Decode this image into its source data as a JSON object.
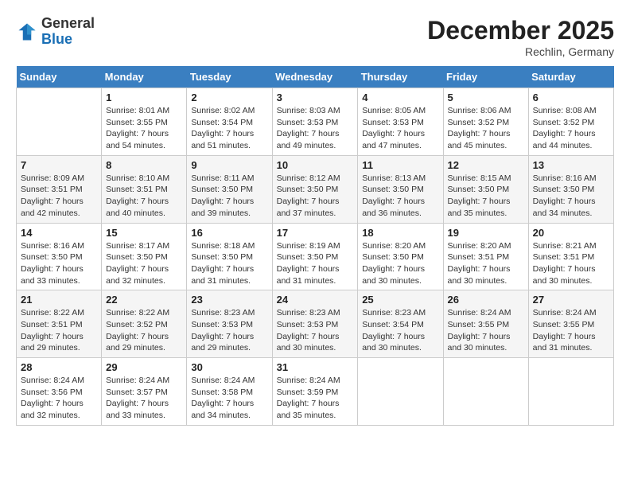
{
  "header": {
    "logo_general": "General",
    "logo_blue": "Blue",
    "month_title": "December 2025",
    "location": "Rechlin, Germany"
  },
  "weekdays": [
    "Sunday",
    "Monday",
    "Tuesday",
    "Wednesday",
    "Thursday",
    "Friday",
    "Saturday"
  ],
  "weeks": [
    [
      {
        "day": "",
        "info": ""
      },
      {
        "day": "1",
        "info": "Sunrise: 8:01 AM\nSunset: 3:55 PM\nDaylight: 7 hours\nand 54 minutes."
      },
      {
        "day": "2",
        "info": "Sunrise: 8:02 AM\nSunset: 3:54 PM\nDaylight: 7 hours\nand 51 minutes."
      },
      {
        "day": "3",
        "info": "Sunrise: 8:03 AM\nSunset: 3:53 PM\nDaylight: 7 hours\nand 49 minutes."
      },
      {
        "day": "4",
        "info": "Sunrise: 8:05 AM\nSunset: 3:53 PM\nDaylight: 7 hours\nand 47 minutes."
      },
      {
        "day": "5",
        "info": "Sunrise: 8:06 AM\nSunset: 3:52 PM\nDaylight: 7 hours\nand 45 minutes."
      },
      {
        "day": "6",
        "info": "Sunrise: 8:08 AM\nSunset: 3:52 PM\nDaylight: 7 hours\nand 44 minutes."
      }
    ],
    [
      {
        "day": "7",
        "info": "Sunrise: 8:09 AM\nSunset: 3:51 PM\nDaylight: 7 hours\nand 42 minutes."
      },
      {
        "day": "8",
        "info": "Sunrise: 8:10 AM\nSunset: 3:51 PM\nDaylight: 7 hours\nand 40 minutes."
      },
      {
        "day": "9",
        "info": "Sunrise: 8:11 AM\nSunset: 3:50 PM\nDaylight: 7 hours\nand 39 minutes."
      },
      {
        "day": "10",
        "info": "Sunrise: 8:12 AM\nSunset: 3:50 PM\nDaylight: 7 hours\nand 37 minutes."
      },
      {
        "day": "11",
        "info": "Sunrise: 8:13 AM\nSunset: 3:50 PM\nDaylight: 7 hours\nand 36 minutes."
      },
      {
        "day": "12",
        "info": "Sunrise: 8:15 AM\nSunset: 3:50 PM\nDaylight: 7 hours\nand 35 minutes."
      },
      {
        "day": "13",
        "info": "Sunrise: 8:16 AM\nSunset: 3:50 PM\nDaylight: 7 hours\nand 34 minutes."
      }
    ],
    [
      {
        "day": "14",
        "info": "Sunrise: 8:16 AM\nSunset: 3:50 PM\nDaylight: 7 hours\nand 33 minutes."
      },
      {
        "day": "15",
        "info": "Sunrise: 8:17 AM\nSunset: 3:50 PM\nDaylight: 7 hours\nand 32 minutes."
      },
      {
        "day": "16",
        "info": "Sunrise: 8:18 AM\nSunset: 3:50 PM\nDaylight: 7 hours\nand 31 minutes."
      },
      {
        "day": "17",
        "info": "Sunrise: 8:19 AM\nSunset: 3:50 PM\nDaylight: 7 hours\nand 31 minutes."
      },
      {
        "day": "18",
        "info": "Sunrise: 8:20 AM\nSunset: 3:50 PM\nDaylight: 7 hours\nand 30 minutes."
      },
      {
        "day": "19",
        "info": "Sunrise: 8:20 AM\nSunset: 3:51 PM\nDaylight: 7 hours\nand 30 minutes."
      },
      {
        "day": "20",
        "info": "Sunrise: 8:21 AM\nSunset: 3:51 PM\nDaylight: 7 hours\nand 30 minutes."
      }
    ],
    [
      {
        "day": "21",
        "info": "Sunrise: 8:22 AM\nSunset: 3:51 PM\nDaylight: 7 hours\nand 29 minutes."
      },
      {
        "day": "22",
        "info": "Sunrise: 8:22 AM\nSunset: 3:52 PM\nDaylight: 7 hours\nand 29 minutes."
      },
      {
        "day": "23",
        "info": "Sunrise: 8:23 AM\nSunset: 3:53 PM\nDaylight: 7 hours\nand 29 minutes."
      },
      {
        "day": "24",
        "info": "Sunrise: 8:23 AM\nSunset: 3:53 PM\nDaylight: 7 hours\nand 30 minutes."
      },
      {
        "day": "25",
        "info": "Sunrise: 8:23 AM\nSunset: 3:54 PM\nDaylight: 7 hours\nand 30 minutes."
      },
      {
        "day": "26",
        "info": "Sunrise: 8:24 AM\nSunset: 3:55 PM\nDaylight: 7 hours\nand 30 minutes."
      },
      {
        "day": "27",
        "info": "Sunrise: 8:24 AM\nSunset: 3:55 PM\nDaylight: 7 hours\nand 31 minutes."
      }
    ],
    [
      {
        "day": "28",
        "info": "Sunrise: 8:24 AM\nSunset: 3:56 PM\nDaylight: 7 hours\nand 32 minutes."
      },
      {
        "day": "29",
        "info": "Sunrise: 8:24 AM\nSunset: 3:57 PM\nDaylight: 7 hours\nand 33 minutes."
      },
      {
        "day": "30",
        "info": "Sunrise: 8:24 AM\nSunset: 3:58 PM\nDaylight: 7 hours\nand 34 minutes."
      },
      {
        "day": "31",
        "info": "Sunrise: 8:24 AM\nSunset: 3:59 PM\nDaylight: 7 hours\nand 35 minutes."
      },
      {
        "day": "",
        "info": ""
      },
      {
        "day": "",
        "info": ""
      },
      {
        "day": "",
        "info": ""
      }
    ]
  ]
}
